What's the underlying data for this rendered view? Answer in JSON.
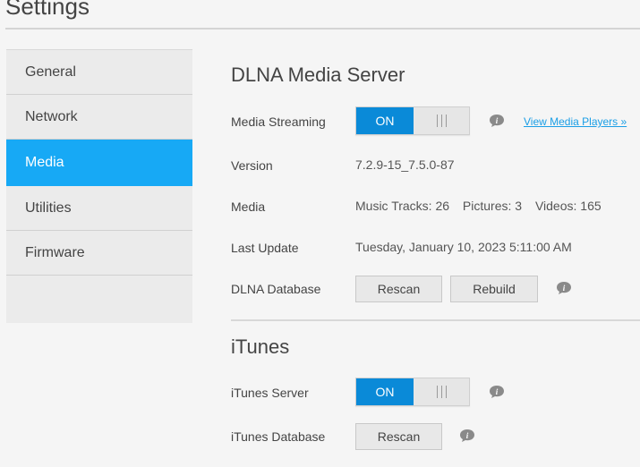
{
  "page": {
    "title": "Settings"
  },
  "sidebar": {
    "items": [
      {
        "label": "General"
      },
      {
        "label": "Network"
      },
      {
        "label": "Media"
      },
      {
        "label": "Utilities"
      },
      {
        "label": "Firmware"
      }
    ],
    "active": "Media"
  },
  "dlna": {
    "title": "DLNA Media Server",
    "streaming_label": "Media Streaming",
    "streaming_state": "ON",
    "view_players_link": "View Media Players »",
    "version_label": "Version",
    "version_value": "7.2.9-15_7.5.0-87",
    "media_label": "Media",
    "music": "Music Tracks: 26",
    "pictures": "Pictures: 3",
    "videos": "Videos: 165",
    "last_update_label": "Last Update",
    "last_update_value": "Tuesday, January 10, 2023 5:11:00 AM",
    "database_label": "DLNA Database",
    "rescan_label": "Rescan",
    "rebuild_label": "Rebuild"
  },
  "itunes": {
    "title": "iTunes",
    "server_label": "iTunes Server",
    "server_state": "ON",
    "database_label": "iTunes Database",
    "rescan_label": "Rescan"
  },
  "colors": {
    "accent": "#17a9f5",
    "toggle_on": "#0a8ad8",
    "link": "#1a9ee6"
  },
  "icons": {
    "info": "info-icon",
    "grip": "toggle-grip-icon"
  }
}
